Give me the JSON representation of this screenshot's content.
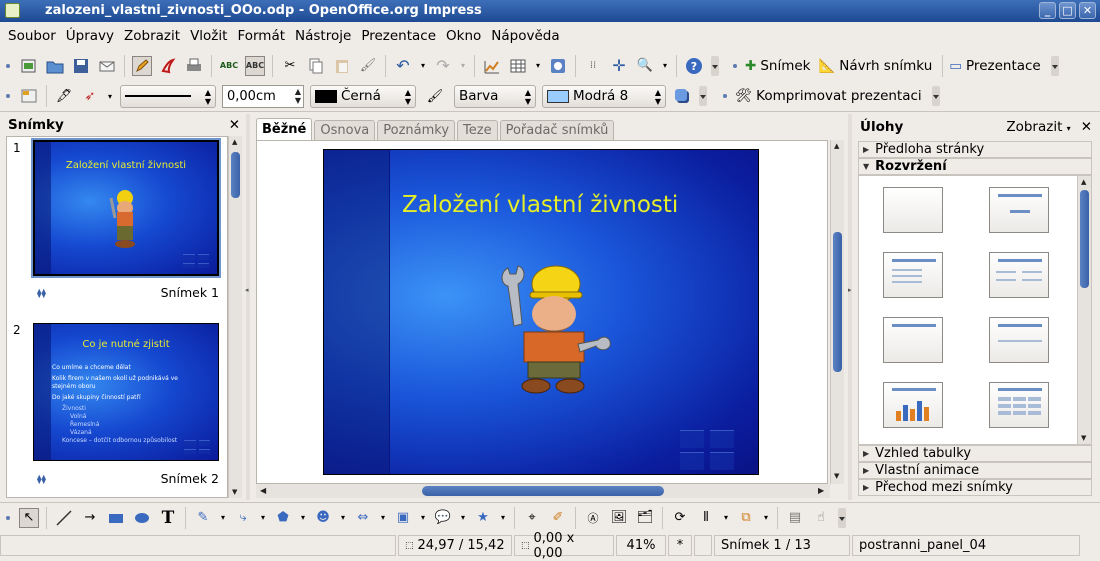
{
  "window": {
    "title": "zalozeni_vlastni_zivnosti_OOo.odp - OpenOffice.org Impress"
  },
  "menu": [
    "Soubor",
    "Úpravy",
    "Zobrazit",
    "Vložit",
    "Formát",
    "Nástroje",
    "Prezentace",
    "Okno",
    "Nápověda"
  ],
  "toolbar1": {
    "slide_label": "Snímek",
    "design_label": "Návrh snímku",
    "presentation_label": "Prezentace"
  },
  "toolbar2": {
    "line_width_value": "0,00cm",
    "line_color_value": "Černá",
    "fill_type_value": "Barva",
    "fill_color_value": "Modrá 8",
    "compress_label": "Komprimovat prezentaci",
    "colors": {
      "line_swatch": "#000000",
      "fill_swatch": "#99ccff"
    }
  },
  "slides_pane": {
    "title": "Snímky",
    "slides": [
      {
        "number": "1",
        "label": "Snímek 1",
        "title": "Založení vlastní živnosti"
      },
      {
        "number": "2",
        "label": "Snímek 2",
        "title": "Co je nutné zjistit",
        "bullets": [
          "Co umíme a chceme dělat",
          "Kolik firem v našem okolí už podnikává ve stejném oboru",
          "Do jaké skupiny činností patří"
        ],
        "subitems": [
          "Živnosti",
          "Volná",
          "Řemeslná",
          "Vázaná",
          "Koncese – dotčit odbornou způsobilost"
        ]
      }
    ]
  },
  "view_tabs": [
    "Běžné",
    "Osnova",
    "Poznámky",
    "Teze",
    "Pořadač snímků"
  ],
  "active_tab": "Běžné",
  "main_slide": {
    "title": "Založení vlastní živnosti"
  },
  "tasks_pane": {
    "title": "Úlohy",
    "view_menu": "Zobrazit",
    "sections": [
      "Předloha stránky",
      "Rozvržení",
      "Vzhled tabulky",
      "Vlastní animace",
      "Přechod mezi snímky"
    ],
    "expanded": "Rozvržení"
  },
  "status": {
    "position": "24,97 / 15,42",
    "size": "0,00 x 0,00",
    "zoom": "41%",
    "modified": "*",
    "slide_of": "Snímek 1 / 13",
    "master": "postranni_panel_04"
  }
}
